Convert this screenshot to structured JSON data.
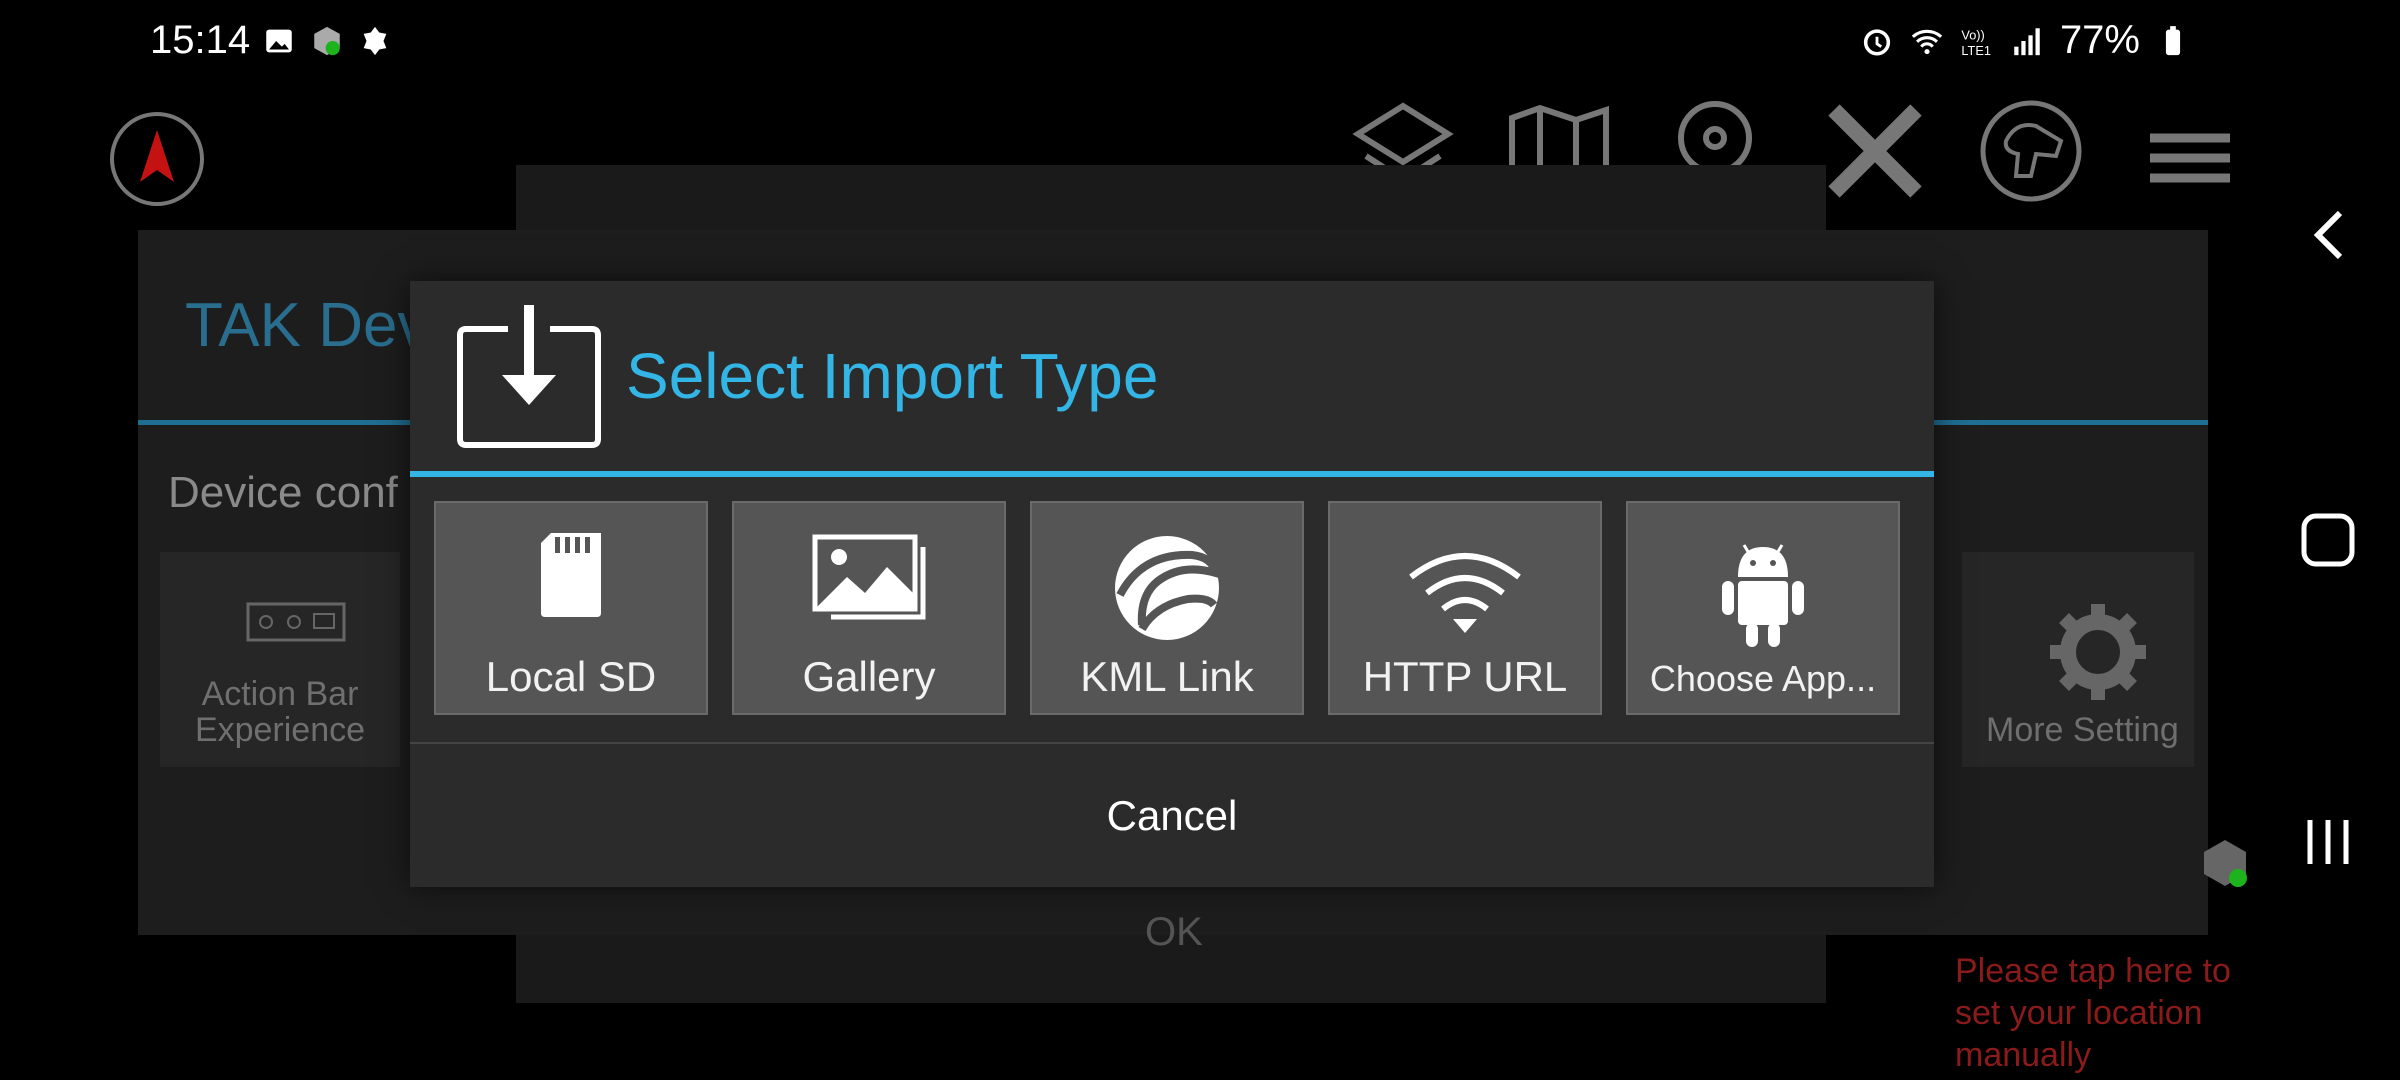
{
  "status_bar": {
    "time": "15:14",
    "battery": "77%",
    "left_icons": [
      "image-icon",
      "tak-app-icon",
      "badge-icon"
    ],
    "right_icons": [
      "alarm-icon",
      "wifi-icon",
      "volte-icon",
      "signal-icon",
      "battery-icon"
    ]
  },
  "toolbar": {
    "icons": [
      "compass-icon",
      "layers-icon",
      "map-icon",
      "radio-icon",
      "close-icon",
      "dog-icon",
      "menu-icon"
    ]
  },
  "background": {
    "panel_title": "TAK Dev",
    "device_label": "Device conf",
    "tiles": [
      {
        "label": "Action Bar\nExperience",
        "icon": "action-bar-icon"
      },
      {
        "label": "More Setting",
        "icon": "gear-icon"
      }
    ],
    "ok_label": "OK",
    "location_hint": "Please tap here to\nset your location\nmanually"
  },
  "dialog": {
    "title": "Select Import Type",
    "icon": "import-download-icon",
    "options": [
      {
        "label": "Local SD",
        "icon": "sd-card-icon"
      },
      {
        "label": "Gallery",
        "icon": "gallery-icon"
      },
      {
        "label": "KML Link",
        "icon": "kml-globe-icon"
      },
      {
        "label": "HTTP URL",
        "icon": "wifi-icon"
      },
      {
        "label": "Choose App...",
        "icon": "android-icon"
      }
    ],
    "cancel_label": "Cancel"
  },
  "colors": {
    "accent": "#33b5e5",
    "dialog_bg": "#2b2b2b",
    "tile_bg": "#555555",
    "warning_text": "#8b1a1a"
  }
}
